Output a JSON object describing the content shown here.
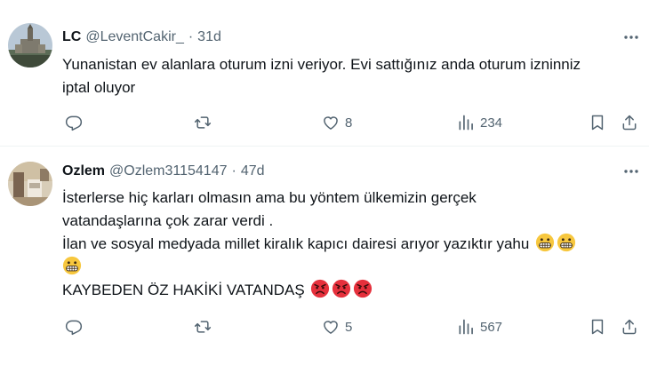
{
  "tweets": [
    {
      "name": "LC",
      "handle": "@LeventCakir_",
      "separator": "·",
      "time": "31d",
      "lines": [
        "Yunanistan ev alanlara oturum izni veriyor. Evi sattığınız anda oturum izninniz",
        "iptal oluyor"
      ],
      "likes": "8",
      "views": "234",
      "avatar_icon": "building-photo-avatar"
    },
    {
      "name": "Ozlem",
      "handle": "@Ozlem31154147",
      "separator": "·",
      "time": "47d",
      "lines": [
        "İsterlerse hiç karları olmasın ama bu yöntem ülkemizin gerçek",
        "vatandaşlarına çok zarar verdi .",
        "İlan ve sosyal medyada millet kiralık kapıcı dairesi arıyor yazıktır yahu",
        "",
        "KAYBEDEN ÖZ HAKİKİ VATANDAŞ"
      ],
      "emoji_grimace": "grimacing-face-emoji",
      "emoji_angry": "angry-face-emoji",
      "likes": "5",
      "views": "567",
      "avatar_icon": "room-photo-avatar"
    }
  ],
  "icons": {
    "more": "more-icon",
    "reply": "reply-icon",
    "retweet": "retweet-icon",
    "like": "heart-icon",
    "views": "views-icon",
    "bookmark": "bookmark-icon",
    "share": "share-icon"
  },
  "colors": {
    "text": "#0f1419",
    "secondary": "#536471",
    "divider": "#eff3f4",
    "emoji_yellow": "#f7c73e",
    "emoji_red": "#e5303c"
  }
}
